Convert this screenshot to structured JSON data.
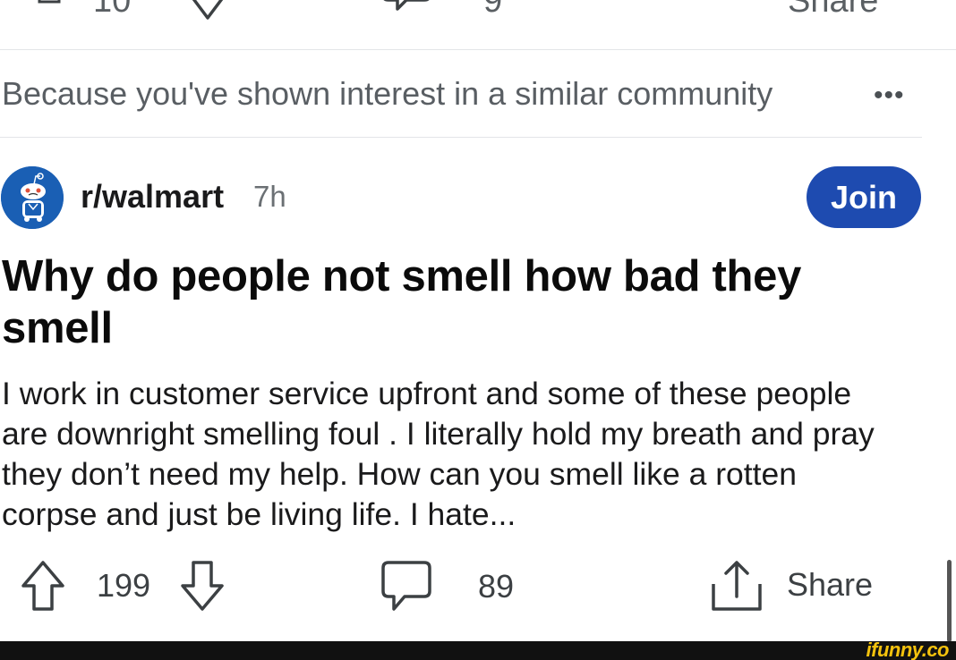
{
  "prev_post": {
    "vote_count_partial": "10",
    "comment_count_partial": "9",
    "share_partial": "Share"
  },
  "recommendation": {
    "reason": "Because you've shown interest in a similar community",
    "more_icon": "ellipsis-icon"
  },
  "post": {
    "subreddit": "r/walmart",
    "time_ago": "7h",
    "join_label": "Join",
    "title": "Why do people not smell how bad they smell",
    "body": "I work in customer service upfront and some of these people are downright smelling foul . I literally hold my breath and pray they don’t need my help. How can you smell like a rotten corpse and just be living life. I hate...",
    "upvotes": "199",
    "comments": "89",
    "share_label": "Share"
  },
  "colors": {
    "join_bg": "#1e4bb0",
    "avatar_bg": "#1a5fb4",
    "muted_text": "#595e63"
  },
  "watermark": "ifunny.co"
}
